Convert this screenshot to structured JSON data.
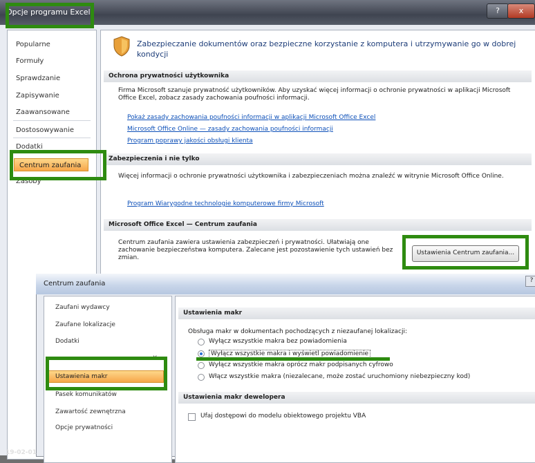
{
  "window": {
    "title": "Opcje programu Excel",
    "help": "?",
    "close": "x"
  },
  "sidebar": {
    "items": [
      "Popularne",
      "Formuły",
      "Sprawdzanie",
      "Zapisywanie",
      "Zaawansowane",
      "Dostosowywanie",
      "Dodatki",
      "Centrum zaufania",
      "Zasoby"
    ]
  },
  "header": {
    "text": "Zabezpieczanie dokumentów oraz bezpieczne korzystanie z komputera i utrzymywanie go w dobrej kondycji"
  },
  "sections": {
    "privacy": {
      "title": "Ochrona prywatności użytkownika",
      "text": "Firma Microsoft szanuje prywatność użytkowników. Aby uzyskać więcej informacji o ochronie prywatności w aplikacji Microsoft Office Excel, zobacz zasady zachowania poufności informacji.",
      "links": [
        "Pokaż zasady zachowania poufności informacji w aplikacji Microsoft Office Excel",
        "Microsoft Office Online — zasady zachowania poufności informacji",
        "Program poprawy jakości obsługi klienta"
      ]
    },
    "security": {
      "title": "Zabezpieczenia i nie tylko",
      "text": "Więcej informacji o ochronie prywatności użytkownika i zabezpieczeniach można znaleźć w witrynie Microsoft Office Online.",
      "link": "Program Wiarygodne technologie komputerowe firmy Microsoft"
    },
    "trust": {
      "title": "Microsoft Office Excel — Centrum zaufania",
      "text": "Centrum zaufania zawiera ustawienia zabezpieczeń i prywatności. Ułatwiają one zachowanie bezpieczeństwa komputera. Zalecane jest pozostawienie tych ustawień bez zmian.",
      "button": "Ustawienia Centrum zaufania..."
    }
  },
  "dialog": {
    "title": "Centrum zaufania",
    "help": "?",
    "sidebar": [
      "Zaufani wydawcy",
      "Zaufane lokalizacje",
      "Dodatki",
      "Ustawienia makr",
      "Pasek komunikatów",
      "Zawartość zewnętrzna",
      "Opcje prywatności"
    ],
    "sidebar_partial": "X",
    "macro_section": "Ustawienia makr",
    "macro_intro": "Obsługa makr w dokumentach pochodzących z niezaufanej lokalizacji:",
    "options": [
      "Wyłącz wszystkie makra bez powiadomienia",
      "Wyłącz wszystkie makra i wyświetl powiadomienie",
      "Wyłącz wszystkie makra oprócz makr podpisanych cyfrowo",
      "Włącz wszystkie makra (niezalecane, może zostać uruchomiony niebezpieczny kod)"
    ],
    "dev_section": "Ustawienia makr dewelopera",
    "dev_checkbox": "Ufaj dostępowi do modelu obiektowego projektu VBA"
  },
  "timestamp": "19-02-01"
}
